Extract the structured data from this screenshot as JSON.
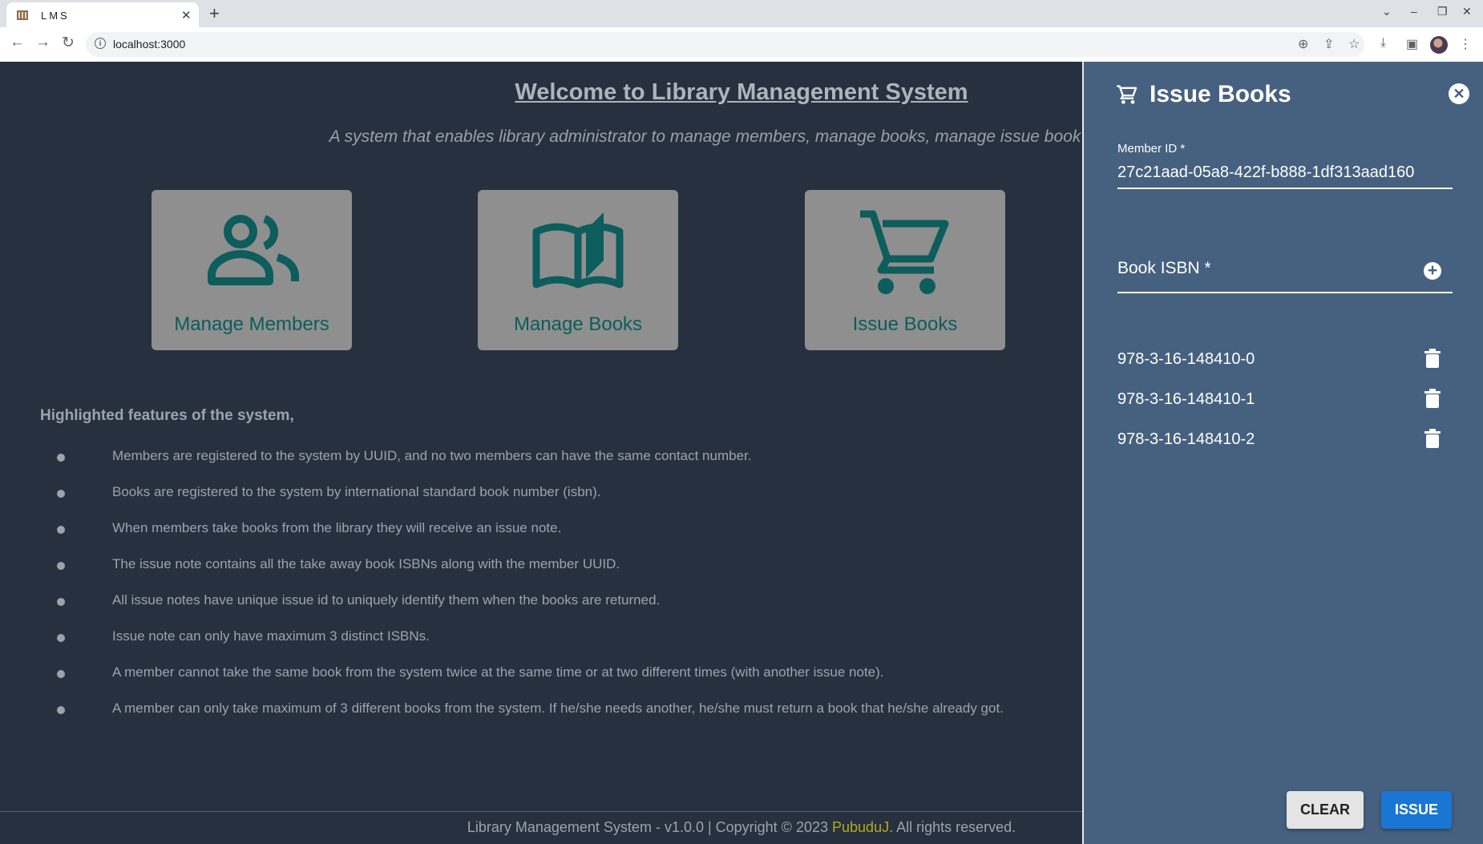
{
  "browser": {
    "tab_title": "LMS",
    "url": "localhost:3000"
  },
  "page": {
    "welcome": "Welcome to Library Management System",
    "subtitle": "A system that enables library administrator to manage members, manage books, manage issue book details ar",
    "cards": [
      {
        "label": "Manage Members",
        "icon": "people-icon"
      },
      {
        "label": "Manage Books",
        "icon": "open-book-icon"
      },
      {
        "label": "Issue Books",
        "icon": "shopping-cart-icon"
      }
    ],
    "features_title": "Highlighted features of the system,",
    "features": [
      "Members are registered to the system by UUID, and no two members can have the same contact number.",
      "Books are registered to the system by international standard book number (isbn).",
      "When members take books from the library they will receive an issue note.",
      "The issue note contains all the take away book ISBNs along with the member UUID.",
      "All issue notes have unique issue id to uniquely identify them when the books are returned.",
      "Issue note can only have maximum 3 distinct ISBNs.",
      "A member cannot take the same book from the system twice at the same time or at two different times (with another issue note).",
      "A member can only take maximum of 3 different books from the system. If he/she needs another, he/she must return a book that he/she already got."
    ],
    "footer_prefix": "Library Management System - v1.0.0 | Copyright © 2023",
    "footer_author": "PubuduJ",
    "footer_suffix": ". All rights reserved."
  },
  "drawer": {
    "title": "Issue Books",
    "member_id_label": "Member ID *",
    "member_id_value": "27c21aad-05a8-422f-b888-1df313aad160",
    "book_isbn_label": "Book ISBN *",
    "books": [
      "978-3-16-148410-0",
      "978-3-16-148410-1",
      "978-3-16-148410-2"
    ],
    "clear_label": "CLEAR",
    "issue_label": "ISSUE"
  },
  "colors": {
    "page_bg": "#26303f",
    "drawer_bg": "#46617f",
    "card_bg": "#8f8f8f",
    "card_icon": "#0c5d5b",
    "issue_button": "#1976d2",
    "footer_author": "#b5a91e"
  }
}
